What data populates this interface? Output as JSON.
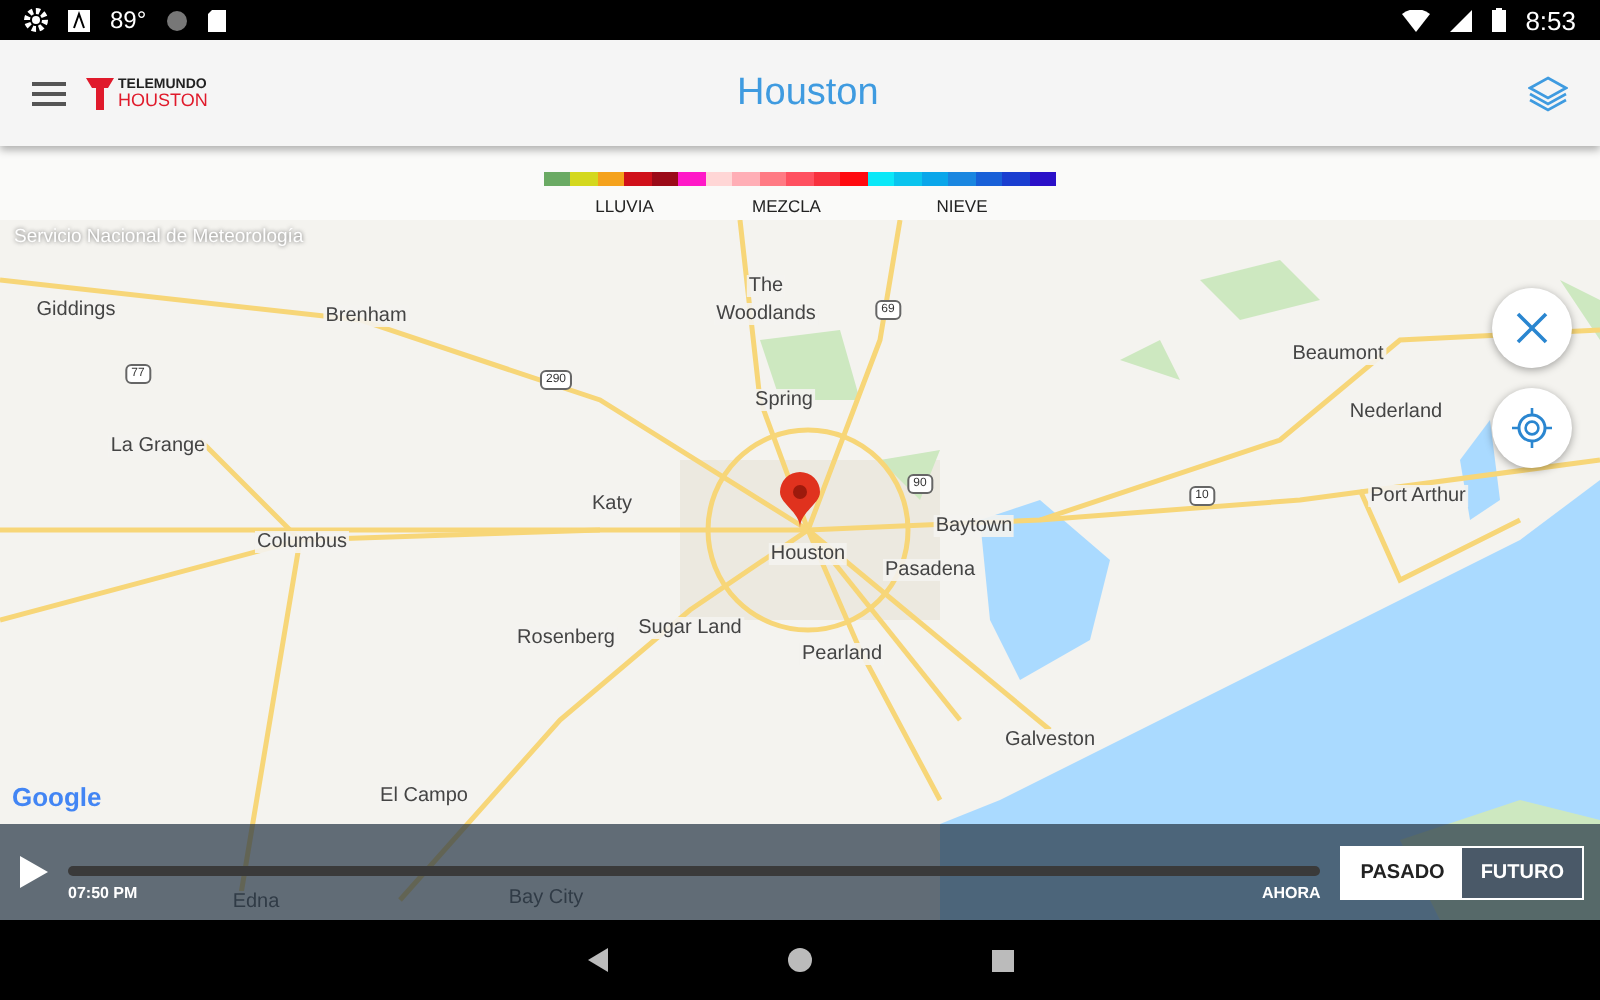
{
  "status_bar": {
    "temperature": "89°",
    "time": "8:53"
  },
  "app_bar": {
    "brand_top": "TELEMUNDO",
    "brand_bottom": "HOUSTON",
    "title": "Houston"
  },
  "legend": [
    {
      "label": "LLUVIA",
      "swatches": [
        {
          "color": "#6aaa64"
        },
        {
          "color": "#d4d81e"
        },
        {
          "color": "#f5a21c"
        },
        {
          "color": "#d0101a"
        },
        {
          "color": "#9b0a18"
        },
        {
          "color": "#ff18c8"
        }
      ]
    },
    {
      "label": "MEZCLA",
      "swatches": [
        {
          "color": "#ffd6d6"
        },
        {
          "color": "#ffaeb6"
        },
        {
          "color": "#ff7a84"
        },
        {
          "color": "#ff5060"
        },
        {
          "color": "#f8303e"
        },
        {
          "color": "#ff0a10"
        }
      ]
    },
    {
      "label": "NIEVE",
      "swatches": [
        {
          "color": "#0ae8f8"
        },
        {
          "color": "#0ac4ee"
        },
        {
          "color": "#0aa6ea"
        },
        {
          "color": "#1a86e0"
        },
        {
          "color": "#1860d8"
        },
        {
          "color": "#1a3ed0"
        },
        {
          "color": "#2a10c8"
        }
      ]
    }
  ],
  "map": {
    "attribution": "Servicio Nacional de Meteorología",
    "logo": "Google",
    "places": [
      {
        "name": "Giddings"
      },
      {
        "name": "Brenham"
      },
      {
        "name": "The"
      },
      {
        "name": "Woodlands"
      },
      {
        "name": "Beaumont"
      },
      {
        "name": "Nederland"
      },
      {
        "name": "Spring"
      },
      {
        "name": "La Grange"
      },
      {
        "name": "Katy"
      },
      {
        "name": "Baytown"
      },
      {
        "name": "Port Arthur"
      },
      {
        "name": "Columbus"
      },
      {
        "name": "Houston"
      },
      {
        "name": "Pasadena"
      },
      {
        "name": "Rosenberg"
      },
      {
        "name": "Sugar Land"
      },
      {
        "name": "Pearland"
      },
      {
        "name": "Galveston"
      },
      {
        "name": "El Campo"
      },
      {
        "name": "Edna"
      },
      {
        "name": "Bay City"
      }
    ],
    "shields": [
      "69",
      "77",
      "290",
      "90",
      "10"
    ]
  },
  "timeline": {
    "time": "07:50 PM",
    "end_label": "AHORA",
    "modes": [
      {
        "label": "PASADO",
        "selected": true
      },
      {
        "label": "FUTURO",
        "selected": false
      }
    ]
  }
}
